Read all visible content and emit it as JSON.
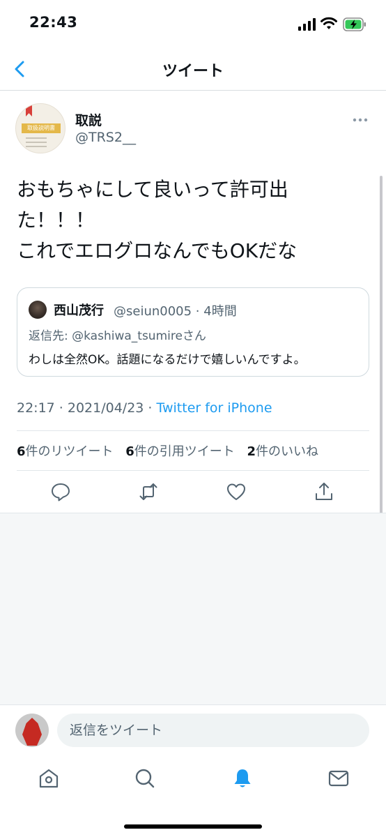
{
  "status_bar": {
    "time": "22:43"
  },
  "nav": {
    "title": "ツイート"
  },
  "tweet": {
    "author_name": "取説",
    "author_handle": "@TRS2__",
    "avatar_label": "取扱説明書",
    "text_lines": [
      "おもちゃにして良いって許可出",
      "た！！！",
      "これでエログロなんでもOKだな"
    ],
    "quote": {
      "name": "西山茂行",
      "handle_time": "@seiun0005 · 4時間",
      "reply_prefix": "返信先: ",
      "reply_to": "@kashiwa_tsumireさん",
      "text": "わしは全然OK。話題になるだけで嬉しいんですよ。"
    },
    "meta_time": "22:17 · 2021/04/23 · ",
    "meta_source": "Twitter for iPhone",
    "stats": {
      "retweets_count": "6",
      "retweets_label": "件のリツイート",
      "quotes_count": "6",
      "quotes_label": "件の引用ツイート",
      "likes_count": "2",
      "likes_label": "件のいいね"
    }
  },
  "reply": {
    "placeholder": "返信をツイート"
  },
  "colors": {
    "accent": "#1d9bf0",
    "secondary_text": "#536471",
    "divider": "#e1e6ea"
  },
  "tabs": [
    {
      "icon": "home-icon"
    },
    {
      "icon": "search-icon"
    },
    {
      "icon": "notifications-icon",
      "active": true
    },
    {
      "icon": "messages-icon"
    }
  ]
}
